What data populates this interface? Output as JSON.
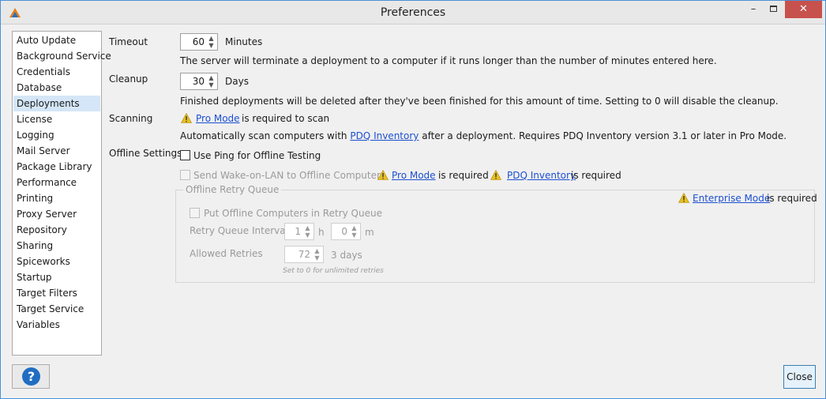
{
  "window": {
    "title": "Preferences"
  },
  "titlebar": {
    "minimize": "–",
    "close": "✕"
  },
  "sidebar": {
    "items": [
      {
        "label": "Auto Update"
      },
      {
        "label": "Background Service"
      },
      {
        "label": "Credentials"
      },
      {
        "label": "Database"
      },
      {
        "label": "Deployments",
        "selected": true
      },
      {
        "label": "License"
      },
      {
        "label": "Logging"
      },
      {
        "label": "Mail Server"
      },
      {
        "label": "Package Library"
      },
      {
        "label": "Performance"
      },
      {
        "label": "Printing"
      },
      {
        "label": "Proxy Server"
      },
      {
        "label": "Repository"
      },
      {
        "label": "Sharing"
      },
      {
        "label": "Spiceworks"
      },
      {
        "label": "Startup"
      },
      {
        "label": "Target Filters"
      },
      {
        "label": "Target Service"
      },
      {
        "label": "Variables"
      }
    ]
  },
  "timeout": {
    "label": "Timeout",
    "value": "60",
    "unit": "Minutes",
    "description": "The server will terminate a deployment to a computer if it runs longer than the number of minutes entered here."
  },
  "cleanup": {
    "label": "Cleanup",
    "value": "30",
    "unit": "Days",
    "description": "Finished deployments will be deleted after they've been finished for this amount of time. Setting to 0 will disable the cleanup."
  },
  "scanning": {
    "label": "Scanning",
    "pro_mode_link": "Pro Mode",
    "required_text": "is required to scan",
    "desc_prefix": "Automatically scan computers with",
    "pdq_inventory_link": "PDQ Inventory",
    "desc_suffix": "after a deployment. Requires PDQ Inventory version 3.1 or later in Pro Mode."
  },
  "offline": {
    "label": "Offline Settings",
    "use_ping": "Use Ping for Offline Testing",
    "wake_on_lan": "Send Wake-on-LAN to Offline Computers",
    "pro_mode_link": "Pro Mode",
    "is_required": "is required",
    "pdq_inventory_link": "PDQ Inventory",
    "is_required_2": "is required"
  },
  "retry_queue": {
    "title": "Offline Retry Queue",
    "enterprise_link": "Enterprise Mode",
    "is_required": "is required",
    "put_offline": "Put Offline Computers in Retry Queue",
    "interval_label": "Retry Queue Interval",
    "interval_hours": "1",
    "hours_unit": "h",
    "interval_minutes": "0",
    "minutes_unit": "m",
    "retries_label": "Allowed Retries",
    "retries_value": "72",
    "retries_days": "3 days",
    "note": "Set to 0 for unlimited retries"
  },
  "buttons": {
    "help": "?",
    "close": "Close"
  },
  "icons": {
    "warning": "warning-icon",
    "help": "help-icon",
    "app": "app-icon"
  },
  "colors": {
    "accent": "#1f6dc2",
    "link": "#1c4fd1",
    "close_hover": "#c7514d",
    "selection": "#d4e6f7"
  }
}
